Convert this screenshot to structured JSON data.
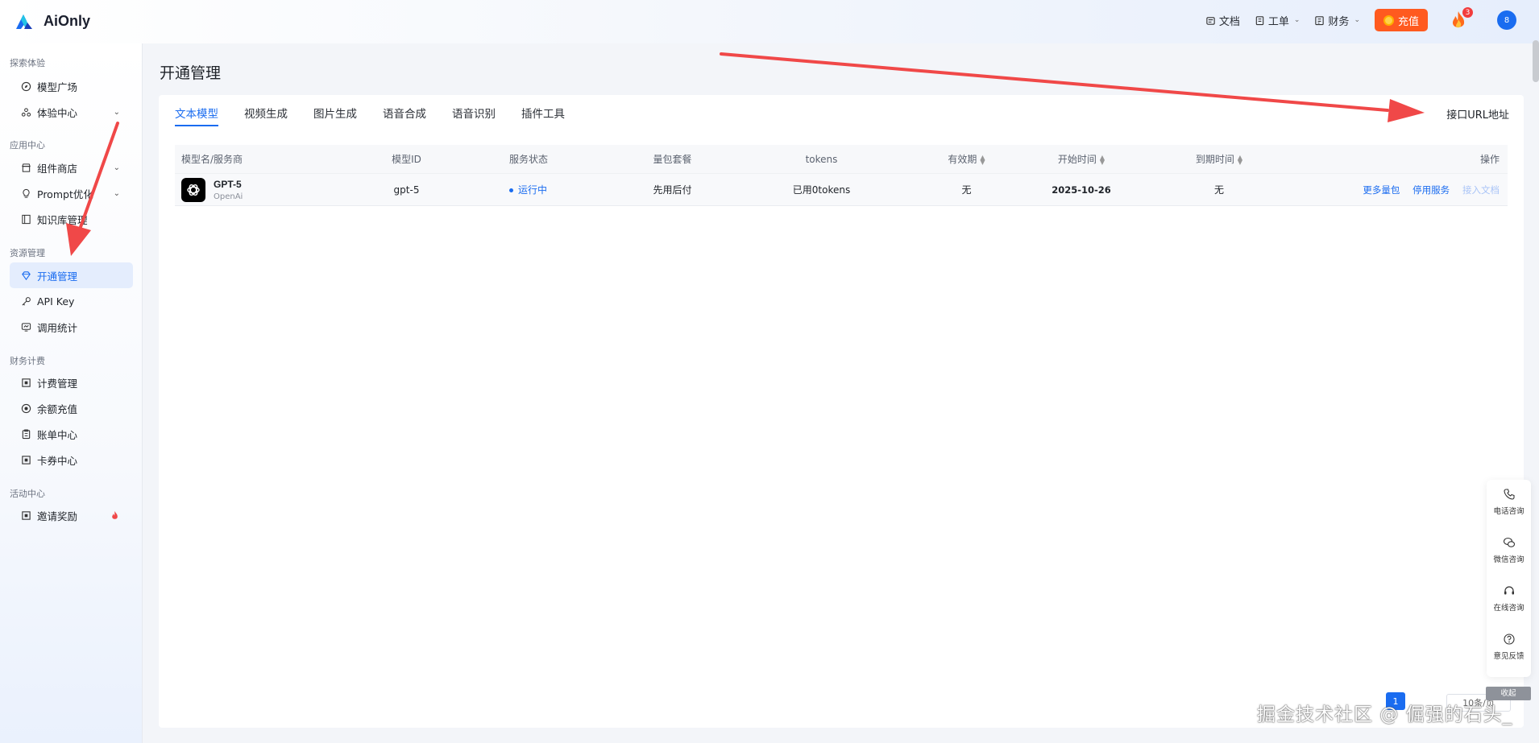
{
  "header": {
    "brand": "AiOnly",
    "nav": [
      {
        "label": "文档",
        "icon": "doc-icon",
        "has_caret": false
      },
      {
        "label": "工单",
        "icon": "ticket-icon",
        "has_caret": true
      },
      {
        "label": "财务",
        "icon": "finance-icon",
        "has_caret": true
      }
    ],
    "recharge_label": "充值",
    "fire_badge": "3",
    "avatar": "8"
  },
  "sidebar": {
    "sections": [
      {
        "title": "探索体验",
        "items": [
          {
            "label": "模型广场",
            "icon": "compass-icon"
          },
          {
            "label": "体验中心",
            "icon": "experience-icon",
            "expandable": true
          }
        ]
      },
      {
        "title": "应用中心",
        "items": [
          {
            "label": "组件商店",
            "icon": "store-icon",
            "expandable": true
          },
          {
            "label": "Prompt优化",
            "icon": "bulb-icon",
            "expandable": true
          },
          {
            "label": "知识库管理",
            "icon": "book-icon"
          }
        ]
      },
      {
        "title": "资源管理",
        "items": [
          {
            "label": "开通管理",
            "icon": "diamond-icon",
            "active": true
          },
          {
            "label": "API Key",
            "icon": "key-icon"
          },
          {
            "label": "调用统计",
            "icon": "stats-icon"
          }
        ]
      },
      {
        "title": "财务计费",
        "items": [
          {
            "label": "计费管理",
            "icon": "billing-icon"
          },
          {
            "label": "余额充值",
            "icon": "balance-icon"
          },
          {
            "label": "账单中心",
            "icon": "bill-icon"
          },
          {
            "label": "卡券中心",
            "icon": "coupon-icon"
          }
        ]
      },
      {
        "title": "活动中心",
        "items": [
          {
            "label": "邀请奖励",
            "icon": "invite-icon",
            "hot": true
          }
        ]
      }
    ]
  },
  "main": {
    "title": "开通管理",
    "tabs": [
      "文本模型",
      "视频生成",
      "图片生成",
      "语音合成",
      "语音识别",
      "插件工具"
    ],
    "active_tab": 0,
    "url_link": "接口URL地址",
    "table": {
      "headers": [
        "模型名/服务商",
        "模型ID",
        "服务状态",
        "量包套餐",
        "tokens",
        "有效期",
        "开始时间",
        "到期时间",
        "操作"
      ],
      "rows": [
        {
          "model_name": "GPT-5",
          "vendor": "OpenAi",
          "model_id": "gpt-5",
          "status": "运行中",
          "package": "先用后付",
          "tokens": "已用0tokens",
          "validity": "无",
          "start_time": "2025-10-26",
          "end_time": "无",
          "actions": [
            "更多量包",
            "停用服务",
            "接入文档"
          ]
        }
      ]
    },
    "pagination": {
      "current_page": "1",
      "page_size": "10条/页"
    }
  },
  "float_bar": {
    "items": [
      "电话咨询",
      "微信咨询",
      "在线咨询",
      "意见反馈"
    ],
    "collapse": "收起"
  },
  "watermark": "掘金技术社区 @ 倔强的石头_",
  "colors": {
    "accent": "#1a6cf0",
    "recharge": "#ff5a1f",
    "arrow": "#f04848"
  }
}
